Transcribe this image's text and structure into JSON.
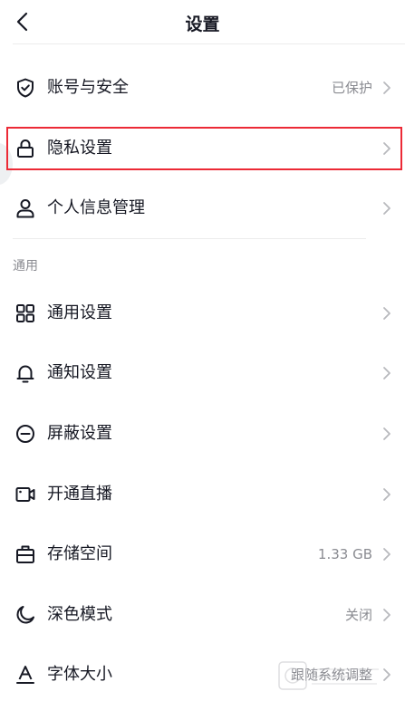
{
  "header": {
    "title": "设置",
    "back_icon": "chevron-left-icon"
  },
  "rows": [
    {
      "label": "账号与安全",
      "value": "已保护",
      "icon": "shield-check-icon"
    },
    {
      "label": "隐私设置",
      "value": "",
      "icon": "lock-icon"
    },
    {
      "label": "个人信息管理",
      "value": "",
      "icon": "user-icon"
    }
  ],
  "section_general": "通用",
  "general_rows": [
    {
      "label": "通用设置",
      "value": "",
      "icon": "grid-icon"
    },
    {
      "label": "通知设置",
      "value": "",
      "icon": "bell-icon"
    },
    {
      "label": "屏蔽设置",
      "value": "",
      "icon": "block-icon"
    },
    {
      "label": "开通直播",
      "value": "",
      "icon": "video-camera-icon"
    },
    {
      "label": "存储空间",
      "value": "1.33 GB",
      "icon": "storage-icon"
    },
    {
      "label": "深色模式",
      "value": "关闭",
      "icon": "moon-icon"
    },
    {
      "label": "字体大小",
      "value": "跟随系统调整",
      "icon": "font-size-icon"
    }
  ],
  "colors": {
    "highlight": "#ec2a36",
    "text": "#161823",
    "secondary": "#8a8b91"
  },
  "watermark_icon": "watermark-stamp-icon"
}
